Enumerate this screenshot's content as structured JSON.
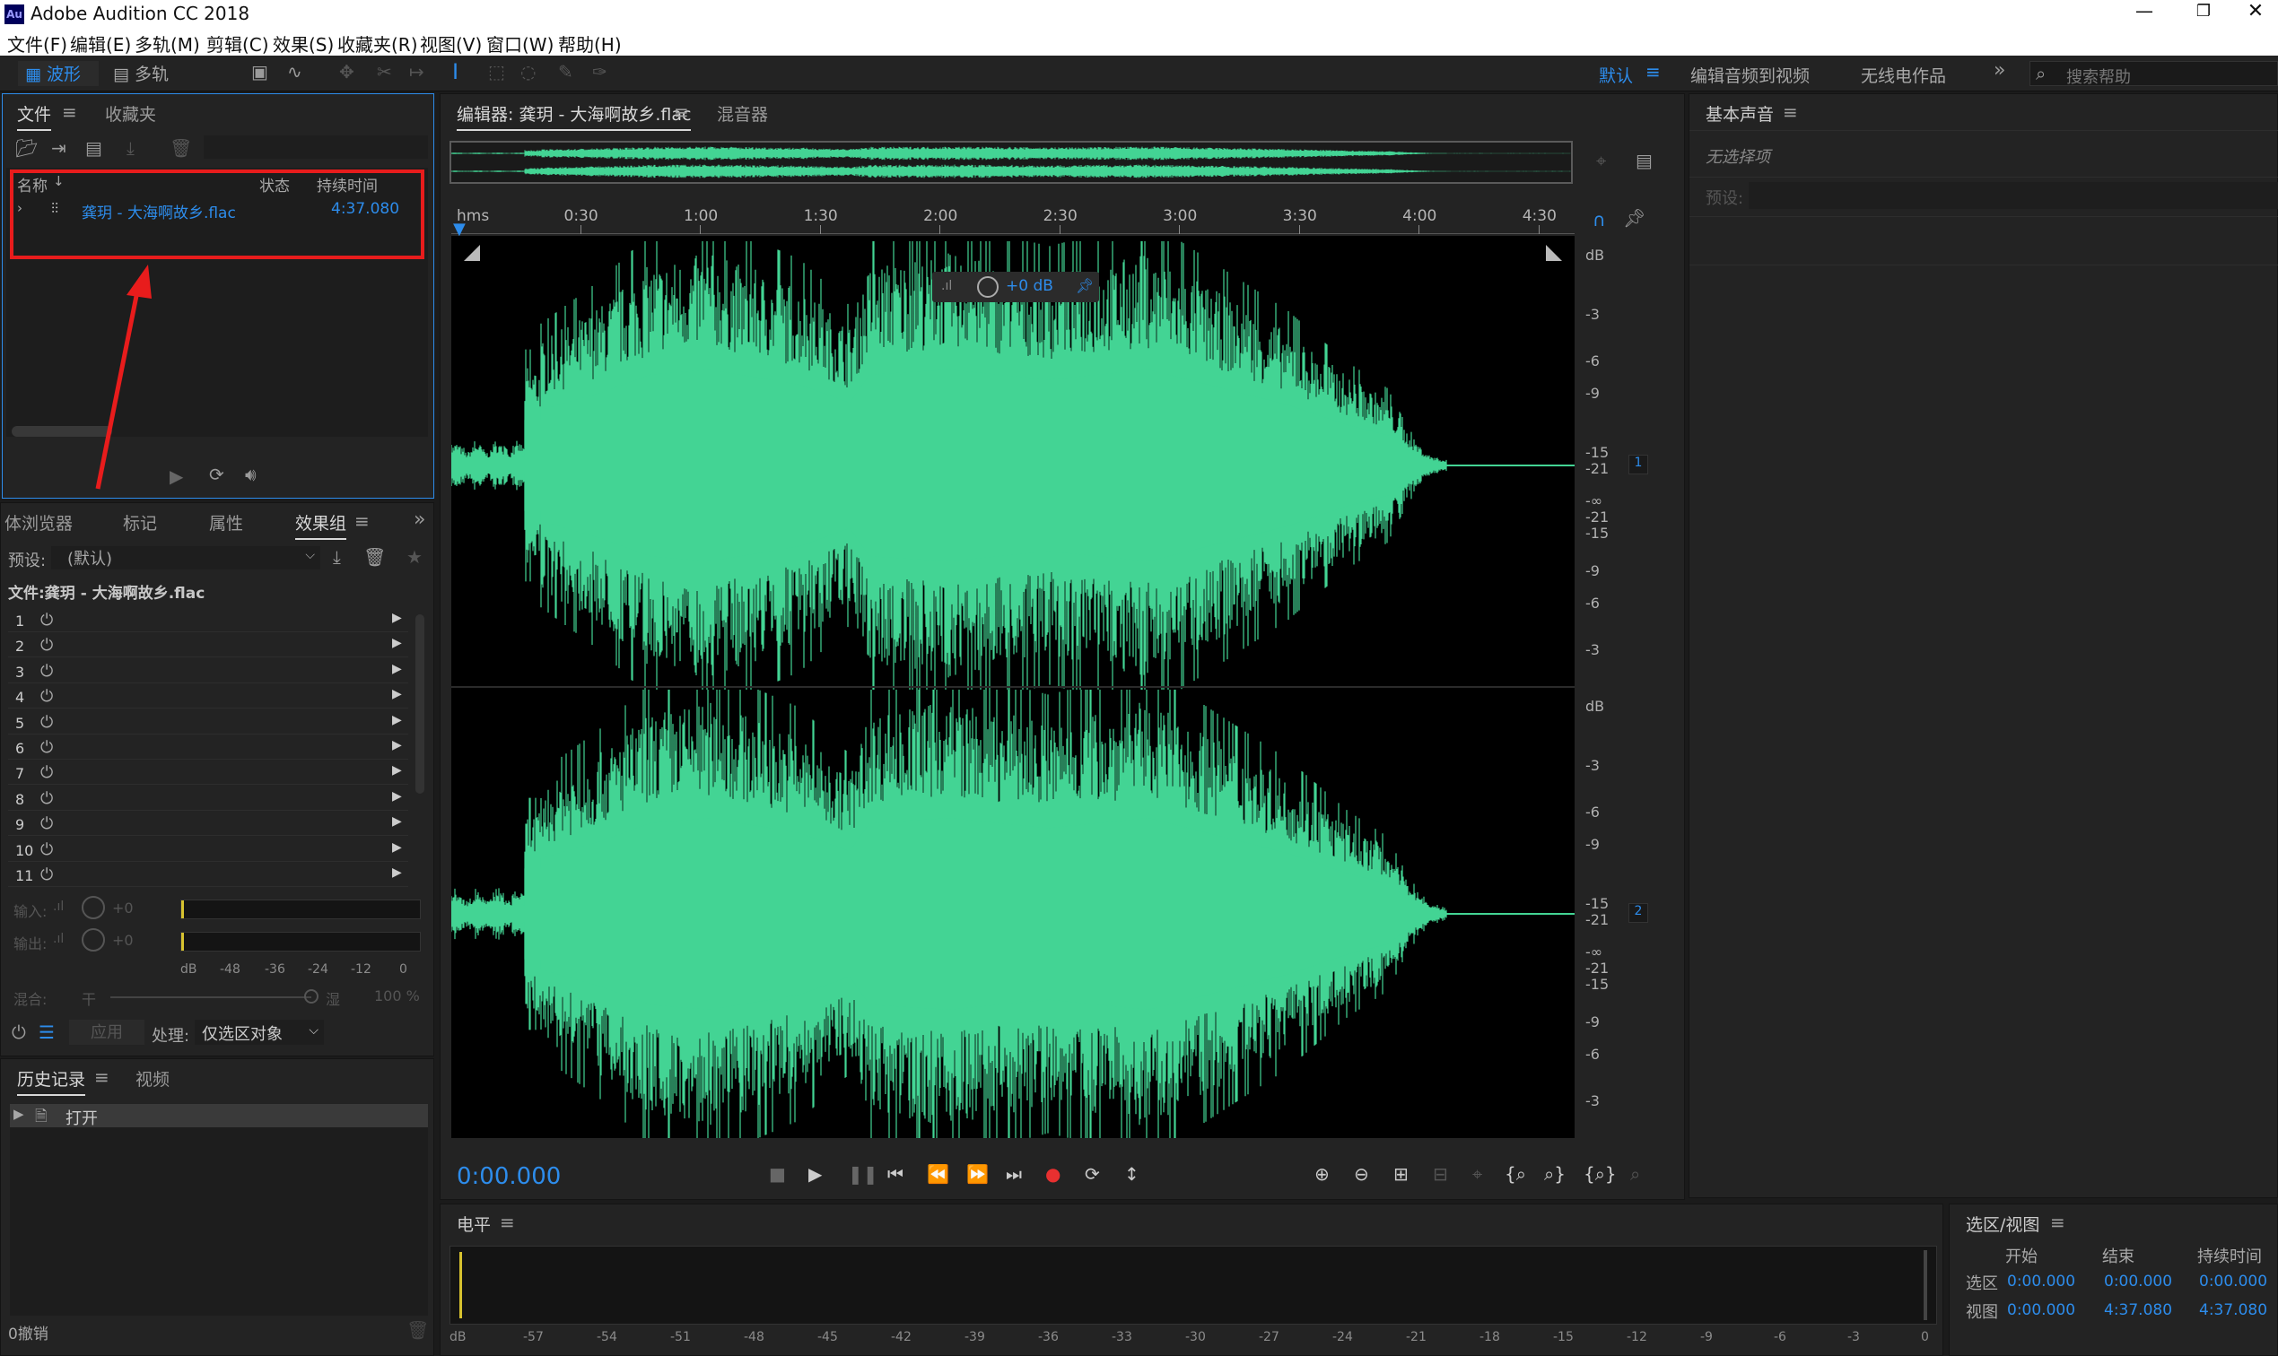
{
  "app": {
    "title": "Adobe Audition CC 2018",
    "icon_text": "Au"
  },
  "menu": [
    "文件(F)",
    "编辑(E)",
    "多轨(M)",
    "剪辑(C)",
    "效果(S)",
    "收藏夹(R)",
    "视图(V)",
    "窗口(W)",
    "帮助(H)"
  ],
  "toolbar": {
    "waveform": "波形",
    "multitrack": "多轨",
    "workspaces": [
      "默认",
      "编辑音频到视频",
      "无线电作品"
    ],
    "search_placeholder": "搜索帮助"
  },
  "files_panel": {
    "tabs": [
      "文件",
      "收藏夹"
    ],
    "columns": [
      "名称",
      "状态",
      "持续时间"
    ],
    "file": {
      "name": "龚玥 - 大海啊故乡.flac",
      "duration": "4:37.080"
    }
  },
  "effects_panel": {
    "tabs": [
      "体浏览器",
      "标记",
      "属性",
      "效果组"
    ],
    "preset_label": "预设:",
    "preset_value": "(默认)",
    "file_label": "文件:龚玥 - 大海啊故乡.flac",
    "slots": [
      "1",
      "2",
      "3",
      "4",
      "5",
      "6",
      "7",
      "8",
      "9",
      "10",
      "11"
    ],
    "input_label": "输入:",
    "output_label": "输出:",
    "gain": "+0",
    "meter_scale": [
      "dB",
      "-48",
      "-36",
      "-24",
      "-12",
      "0"
    ],
    "mix_label": "混合:",
    "mix_dry": "干",
    "mix_wet": "湿",
    "mix_pct": "100 %",
    "apply_label": "应用",
    "process_label": "处理:",
    "process_value": "仅选区对象"
  },
  "history_panel": {
    "tabs": [
      "历史记录",
      "视频"
    ],
    "item": "打开",
    "undo_label": "0撤销"
  },
  "editor": {
    "tab": "编辑器: 龚玥 - 大海啊故乡.flac",
    "mixer_tab": "混音器",
    "ruler_unit": "hms",
    "ruler": [
      "0:30",
      "1:00",
      "1:30",
      "2:00",
      "2:30",
      "3:00",
      "3:30",
      "4:00",
      "4:30"
    ],
    "hud_gain": "+0 dB",
    "db_scale": [
      "dB",
      "-3",
      "-6",
      "-9",
      "-15",
      "-21",
      "-∞",
      "-21",
      "-15",
      "-9",
      "-6",
      "-3"
    ],
    "channels": [
      "1",
      "2"
    ],
    "time": "0:00.000"
  },
  "levels_panel": {
    "title": "电平",
    "scale": [
      "dB",
      "-57",
      "-54",
      "-51",
      "-48",
      "-45",
      "-42",
      "-39",
      "-36",
      "-33",
      "-30",
      "-27",
      "-24",
      "-21",
      "-18",
      "-15",
      "-12",
      "-9",
      "-6",
      "-3",
      "0"
    ]
  },
  "essential_sound": {
    "title": "基本声音",
    "no_selection": "无选择项",
    "preset_label": "预设:"
  },
  "selection_view": {
    "title": "选区/视图",
    "headers": [
      "开始",
      "结束",
      "持续时间"
    ],
    "rows": [
      {
        "label": "选区",
        "start": "0:00.000",
        "end": "0:00.000",
        "duration": "0:00.000"
      },
      {
        "label": "视图",
        "start": "0:00.000",
        "end": "4:37.080",
        "duration": "4:37.080"
      }
    ]
  },
  "colors": {
    "waveform": "#43d494",
    "accent": "#2d8ceb",
    "highlight": "#e81c1c",
    "record": "#e83030"
  }
}
